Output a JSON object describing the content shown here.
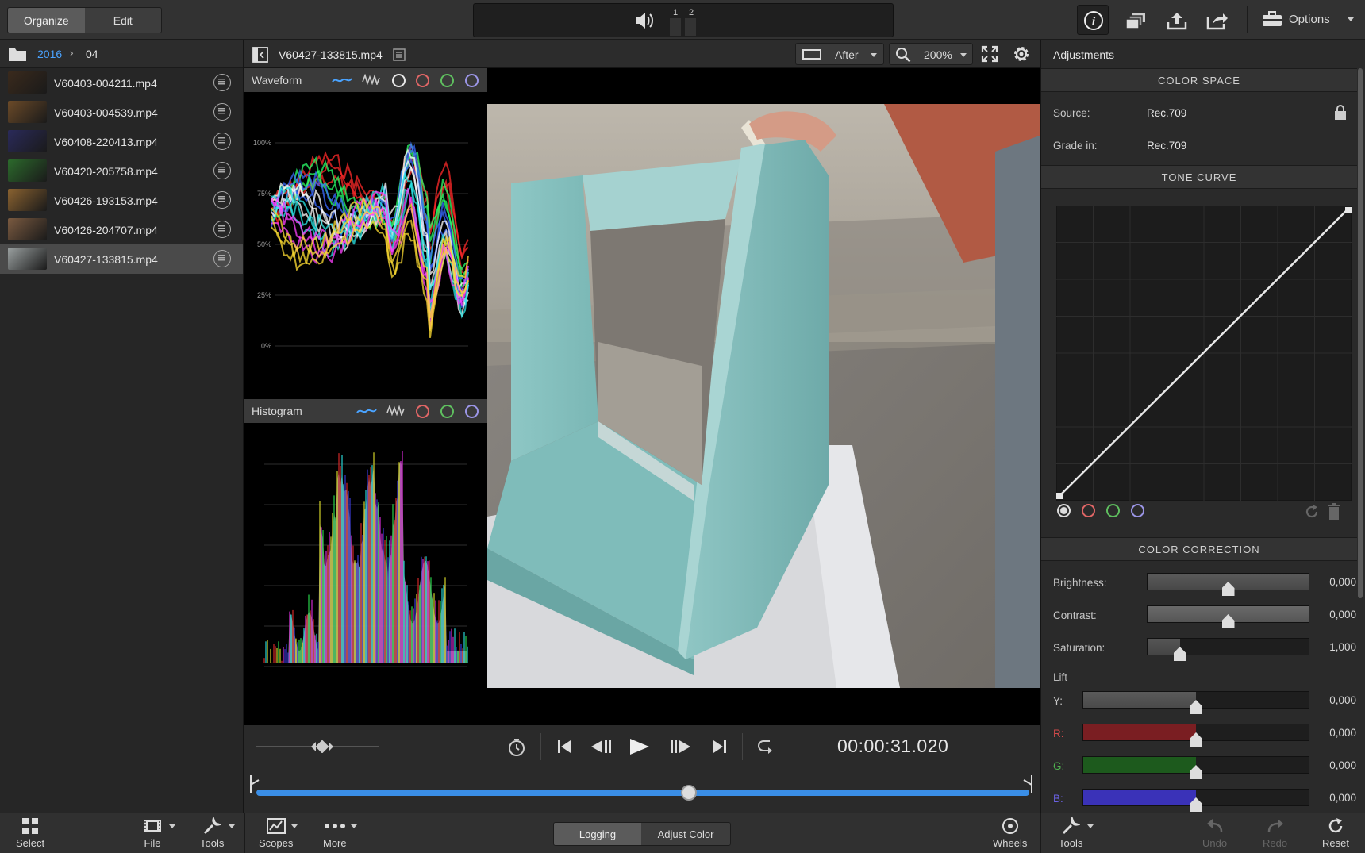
{
  "topbar": {
    "tab_organize": "Organize",
    "tab_edit": "Edit",
    "audio_channel_1": "1",
    "audio_channel_2": "2",
    "options_label": "Options"
  },
  "breadcrumb": {
    "year": "2016",
    "month": "04"
  },
  "files": [
    {
      "name": "V60403-004211.mp4",
      "thumb": "#3a2a1c",
      "selected": false
    },
    {
      "name": "V60403-004539.mp4",
      "thumb": "#6b4a28",
      "selected": false
    },
    {
      "name": "V60408-220413.mp4",
      "thumb": "#2a2a5a",
      "selected": false
    },
    {
      "name": "V60420-205758.mp4",
      "thumb": "#2c6a2c",
      "selected": false
    },
    {
      "name": "V60426-193153.mp4",
      "thumb": "#8a6230",
      "selected": false
    },
    {
      "name": "V60426-204707.mp4",
      "thumb": "#7a5a40",
      "selected": false
    },
    {
      "name": "V60427-133815.mp4",
      "thumb": "#9aa0a0",
      "selected": true
    }
  ],
  "viewer": {
    "filename": "V60427-133815.mp4",
    "compare_mode": "After",
    "zoom": "200%"
  },
  "scopes": {
    "waveform_title": "Waveform",
    "waveform_ticks": [
      "100%",
      "75%",
      "50%",
      "25%",
      "0%"
    ],
    "histogram_title": "Histogram"
  },
  "transport": {
    "timecode": "00:00:31.020",
    "playhead_fraction": 0.56
  },
  "adjustments": {
    "title": "Adjustments",
    "color_space_header": "COLOR SPACE",
    "source_label": "Source:",
    "source_value": "Rec.709",
    "grade_label": "Grade in:",
    "grade_value": "Rec.709",
    "tone_curve_header": "TONE CURVE",
    "color_correction_header": "COLOR CORRECTION",
    "brightness_label": "Brightness:",
    "brightness_value": "0,000",
    "brightness_level": 0.5,
    "contrast_label": "Contrast:",
    "contrast_value": "0,000",
    "contrast_level": 0.5,
    "saturation_label": "Saturation:",
    "saturation_value": "1,000",
    "saturation_level": 0.2,
    "lift_label": "Lift",
    "lift_y_label": "Y:",
    "lift_y_value": "0,000",
    "lift_r_label": "R:",
    "lift_r_value": "0,000",
    "lift_g_label": "G:",
    "lift_g_value": "0,000",
    "lift_b_label": "B:",
    "lift_b_value": "0,000",
    "lift_level": 0.5
  },
  "bottombar": {
    "select": "Select",
    "file": "File",
    "tools": "Tools",
    "scopes": "Scopes",
    "more": "More",
    "logging": "Logging",
    "adjust_color": "Adjust Color",
    "wheels": "Wheels",
    "tools_right": "Tools",
    "undo": "Undo",
    "redo": "Redo",
    "reset": "Reset"
  },
  "colors": {
    "accent_blue": "#3a8ee6",
    "red": "#e06666",
    "green": "#5fbf5f",
    "violet": "#9b95e6",
    "lift_r": "#7a1e22",
    "lift_g": "#1d5a1d",
    "lift_b": "#3a32b8"
  }
}
